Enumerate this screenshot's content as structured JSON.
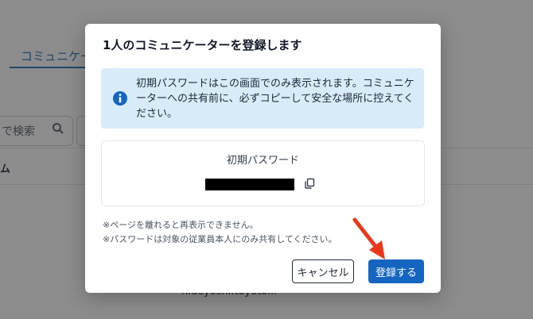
{
  "background": {
    "tab_label": "コミュニケー",
    "search_placeholder": "で検索",
    "column_header": "ム",
    "email_partial": "hideyoshi.toyoto..."
  },
  "modal": {
    "title": "1人のコミュニケーターを登録します",
    "info_text": "初期パスワードはこの画面でのみ表示されます。コミュニケーターへの共有前に、必ずコピーして安全な場所に控えてください。",
    "password_label": "初期パスワード",
    "password_value": "",
    "note1": "※ページを離れると再表示できません。",
    "note2": "※パスワードは対象の従業員本人にのみ共有してください。",
    "cancel_label": "キャンセル",
    "register_label": "登録する"
  },
  "colors": {
    "primary": "#1565c0",
    "info_bg": "#d7ebf9",
    "annotation_arrow": "#e8391b"
  },
  "icons": {
    "info": "info-circle-icon",
    "copy": "copy-icon",
    "search": "search-icon"
  }
}
